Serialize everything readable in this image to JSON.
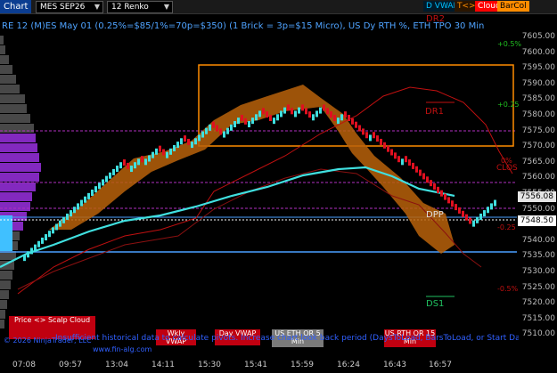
{
  "toolbar": {
    "title": "Chart",
    "instrument": "MES SEP26",
    "bar_type": "12 Renko",
    "buttons": [
      {
        "label": "D VWAP",
        "color": "#00c0ff"
      },
      {
        "label": "T<>K",
        "color": "#ff8c00"
      },
      {
        "label": "Cloud",
        "color": "#ff0000"
      },
      {
        "label": "BarCol",
        "color": "#ff8c00"
      }
    ]
  },
  "info_line": "RE 12 (M)ES May 01 (0.25%=$85/1%=70p=$350) (1 Brick = 3p=$15 Micro), US Dy RTH %, ETH TPO 30 Min",
  "price_axis": {
    "labels": [
      "7605.00",
      "7600.00",
      "7595.00",
      "7590.00",
      "7585.00",
      "7580.00",
      "7575.00",
      "7570.00",
      "7565.00",
      "7560.00",
      "7555.00",
      "7550.00",
      "7545.00",
      "7540.00",
      "7535.00",
      "7530.00",
      "7525.00",
      "7520.00",
      "7515.00",
      "7510.00"
    ],
    "current_price": "7556.08",
    "last_price": "7548.50"
  },
  "pct_labels": [
    "+0.5%",
    "+0.25",
    "0%",
    "-0.25",
    "-0.5%"
  ],
  "level_labels": {
    "dr2": "DR2",
    "dr1": "DR1",
    "clos": "CLOS",
    "dpp": "DPP",
    "ds1": "DS1"
  },
  "time_axis": [
    "07:08",
    "09:57",
    "13:04",
    "14:11",
    "15:30",
    "15:41",
    "15:59",
    "16:24",
    "16:43",
    "16:57"
  ],
  "bottom_boxes": {
    "price_scalp": "Price <> Scalp Cloud",
    "wkly_vwap": "Wkly VWAP",
    "day_vwap": "Day VWAP",
    "us_eth_or": "US ETH OR 5 Min",
    "us_rth_or": "US RTH OR 15 Min"
  },
  "status_message": "Insufficient historical data to calculate pivots. Increase chart look back period (DaysToLoad, BarsToLoad, or Start Date)",
  "copyright": "© 2026 NinjaTrader, LLC",
  "website": "www.fin-alg.com",
  "colors": {
    "renko_up": "#40e0e0",
    "renko_down": "#e01020",
    "cloud": "#b8620a",
    "vwap": "#40e0e0",
    "tpo": "#8a2be2",
    "or_box": "#ff8c00"
  }
}
